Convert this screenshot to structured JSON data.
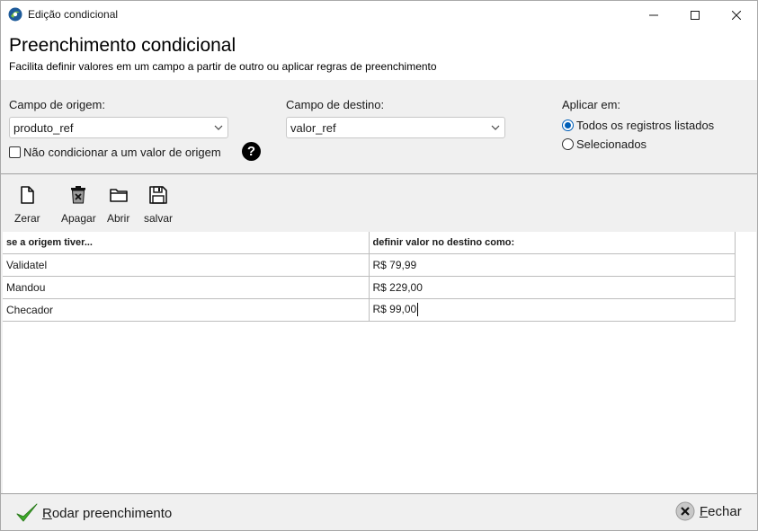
{
  "window": {
    "title": "Edição condicional",
    "accent_color": "#005fb8"
  },
  "header": {
    "title": "Preenchimento condicional",
    "subtitle": "Facilita definir valores em um campo a partir de outro ou aplicar regras de preenchimento"
  },
  "options": {
    "origin_label": "Campo de origem:",
    "origin_value": "produto_ref",
    "dest_label": "Campo de destino:",
    "dest_value": "valor_ref",
    "no_condition_label": "Não condicionar a um valor de origem",
    "no_condition_checked": false,
    "help_glyph": "?",
    "apply_label": "Aplicar em:",
    "apply_all_label": "Todos os registros listados",
    "apply_selected_label": "Selecionados",
    "apply_value": "all"
  },
  "toolbar": {
    "reset_label": "Zerar",
    "delete_label": "Apagar",
    "open_label": "Abrir",
    "save_label": "salvar"
  },
  "grid": {
    "col_origin": "se a origem tiver...",
    "col_dest": "definir valor no destino como:",
    "rows": [
      {
        "origin": "Validatel",
        "dest": "R$ 79,99"
      },
      {
        "origin": "Mandou",
        "dest": "R$ 229,00"
      },
      {
        "origin": "Checador",
        "dest": "R$ 99,00"
      }
    ]
  },
  "footer": {
    "run_first": "R",
    "run_rest": "odar preenchimento",
    "close_first": "F",
    "close_rest": "echar"
  }
}
